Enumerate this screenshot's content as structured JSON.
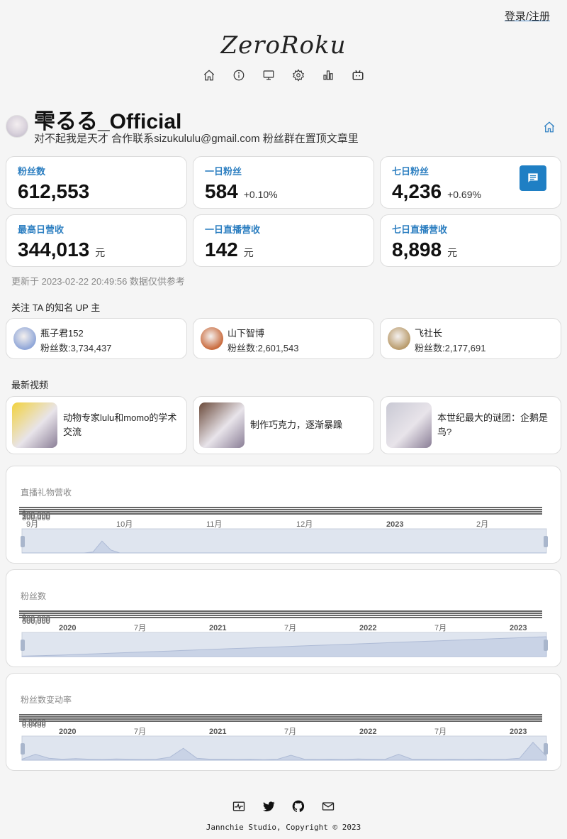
{
  "header": {
    "login_label": "登录/注册",
    "logo_text": "ZeroRoku",
    "nav_icons": [
      "home-icon",
      "info-icon",
      "monitor-icon",
      "settings-icon",
      "bar-chart-icon",
      "bilibili-icon"
    ]
  },
  "profile": {
    "name": "雫るる_Official",
    "sign": "对不起我是天才 合作联系sizukululu@gmail.com 粉丝群在置顶文章里",
    "home_icon": "home-icon"
  },
  "stats": [
    {
      "label": "粉丝数",
      "value": "612,553",
      "extra": "",
      "unit": ""
    },
    {
      "label": "一日粉丝",
      "value": "584",
      "extra": "+0.10%",
      "unit": ""
    },
    {
      "label": "七日粉丝",
      "value": "4,236",
      "extra": "+0.69%",
      "unit": ""
    },
    {
      "label": "最高日营收",
      "value": "344,013",
      "extra": "",
      "unit": "元"
    },
    {
      "label": "一日直播营收",
      "value": "142",
      "extra": "",
      "unit": "元"
    },
    {
      "label": "七日直播营收",
      "value": "8,898",
      "extra": "",
      "unit": "元"
    }
  ],
  "updated_text": "更新于 2023-02-22 20:49:56 数据仅供参考",
  "up_section": {
    "title": "关注 TA 的知名 UP 主",
    "items": [
      {
        "name": "瓶子君152",
        "fans": "粉丝数:3,734,437",
        "color": "#8fa6d8"
      },
      {
        "name": "山下智博",
        "fans": "粉丝数:2,601,543",
        "color": "#c96a3c"
      },
      {
        "name": "飞社长",
        "fans": "粉丝数:2,177,691",
        "color": "#b89a6a"
      }
    ]
  },
  "video_section": {
    "title": "最新视频",
    "items": [
      {
        "title": "动物专家lulu和momo的学术交流",
        "color": "#f2d23c"
      },
      {
        "title": "制作巧克力，逐渐暴躁",
        "color": "#6b4a3a"
      },
      {
        "title": "本世纪最大的谜团：企鹅是鸟?",
        "color": "#c9c9d4"
      }
    ]
  },
  "chart_data": [
    {
      "type": "line",
      "title": "直播礼物营收",
      "x_ticks": [
        "9月",
        "10月",
        "11月",
        "12月",
        "2023",
        "2月"
      ],
      "bold_ticks": [
        "2023"
      ],
      "y_tick_labels": [
        "300,000",
        "200,000",
        "100,000",
        "0"
      ],
      "overview": [
        0,
        0,
        0,
        0,
        0,
        0,
        0,
        0,
        0.05,
        0.6,
        0.15,
        0,
        0,
        0,
        0,
        0,
        0,
        0,
        0,
        0,
        0,
        0,
        0,
        0,
        0,
        0,
        0,
        0,
        0,
        0,
        0,
        0,
        0,
        0,
        0,
        0,
        0,
        0,
        0,
        0,
        0,
        0,
        0,
        0,
        0,
        0,
        0,
        0,
        0,
        0,
        0,
        0,
        0,
        0,
        0,
        0,
        0,
        0,
        0,
        0
      ]
    },
    {
      "type": "area",
      "title": "粉丝数",
      "x_ticks": [
        "2020",
        "7月",
        "2021",
        "7月",
        "2022",
        "7月",
        "2023"
      ],
      "bold_ticks": [
        "2020",
        "2021",
        "2022",
        "2023"
      ],
      "y_tick_labels": [
        "600,000",
        "400,000",
        "200,000",
        "0"
      ],
      "overview": [
        0.02,
        0.05,
        0.08,
        0.12,
        0.16,
        0.2,
        0.24,
        0.28,
        0.32,
        0.36,
        0.4,
        0.44,
        0.48,
        0.52,
        0.56,
        0.6,
        0.64,
        0.68,
        0.72,
        0.76,
        0.8,
        0.84,
        0.88,
        0.92,
        0.96,
        1.0
      ]
    },
    {
      "type": "line",
      "title": "粉丝数变动率",
      "x_ticks": [
        "2020",
        "7月",
        "2021",
        "7月",
        "2022",
        "7月",
        "2023"
      ],
      "bold_ticks": [
        "2020",
        "2021",
        "2022",
        "2023"
      ],
      "y_tick_labels": [
        "0.0400",
        "0.0200",
        "0.0000"
      ],
      "overview": [
        0.05,
        0.3,
        0.1,
        0.05,
        0.08,
        0.05,
        0.04,
        0.06,
        0.05,
        0.04,
        0.05,
        0.15,
        0.6,
        0.1,
        0.05,
        0.05,
        0.04,
        0.05,
        0.03,
        0.05,
        0.25,
        0.05,
        0.04,
        0.05,
        0.04,
        0.06,
        0.05,
        0.04,
        0.3,
        0.05,
        0.05,
        0.04,
        0.05,
        0.04,
        0.05,
        0.04,
        0.05,
        0.1,
        0.9,
        0.2
      ]
    }
  ],
  "footer": {
    "icons": [
      "pulse-icon",
      "twitter-icon",
      "github-icon",
      "mail-icon"
    ],
    "copyright": "Jannchie Studio, Copyright © 2023"
  },
  "colors": {
    "accent": "#2d7fc1",
    "chat_button": "#1f7fc4",
    "slider_fill": "#d6deeb",
    "line_blue": "#3a7bd5"
  }
}
